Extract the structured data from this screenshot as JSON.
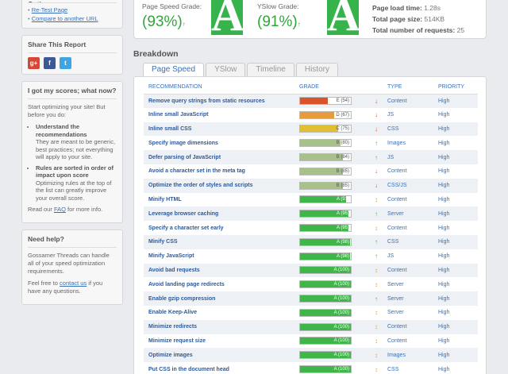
{
  "sidebar": {
    "top": {
      "title": "Options",
      "retest": "Re-Test Page",
      "compare": "Compare to another URL"
    },
    "share": {
      "title": "Share This Report"
    },
    "scores": {
      "title": "I got my scores; what now?",
      "intro": "Start optimizing your site! But before you do:",
      "item1_title": "Understand the recommendations",
      "item1_text": "They are meant to be generic, best practices; not everything will apply to your site.",
      "item2_title": "Rules are sorted in order of impact upon score",
      "item2_text": "Optimizing rules at the top of the list can greatly improve your overall score.",
      "read_pre": "Read our ",
      "faq": "FAQ",
      "read_post": " for more info."
    },
    "help": {
      "title": "Need help?",
      "text": "Gossamer Threads can handle all of your speed optimization requirements.",
      "feel_pre": "Feel free to ",
      "contact": "contact us",
      "feel_post": " if you have any questions."
    }
  },
  "grades": {
    "pagespeed_label": "Page Speed Grade:",
    "pagespeed_value": "(93%)",
    "yslow_label": "YSlow Grade:",
    "yslow_value": "(91%)",
    "letter": "A",
    "arrow": "↑",
    "load_time_label": "Page load time:",
    "load_time": "1.28s",
    "page_size_label": "Total page size:",
    "page_size": "514KB",
    "requests_label": "Total number of requests:",
    "requests": "25"
  },
  "breakdown": "Breakdown",
  "tabs": [
    "Page Speed",
    "YSlow",
    "Timeline",
    "History"
  ],
  "table": {
    "headers": [
      "RECOMMENDATION",
      "GRADE",
      "TYPE",
      "PRIORITY"
    ],
    "rows": [
      {
        "rec": "Remove query strings from static resources",
        "grade": "E (54)",
        "score": 54,
        "arrow": "↓",
        "type": "Content",
        "priority": "High",
        "color": "#d9542b"
      },
      {
        "rec": "Inline small JavaScript",
        "grade": "D (67)",
        "score": 67,
        "arrow": "↓",
        "type": "JS",
        "priority": "High",
        "color": "#e89b3c"
      },
      {
        "rec": "Inline small CSS",
        "grade": "C (75)",
        "score": 75,
        "arrow": "↓",
        "type": "CSS",
        "priority": "High",
        "color": "#e0c030"
      },
      {
        "rec": "Specify image dimensions",
        "grade": "B (80)",
        "score": 80,
        "arrow": "↑",
        "type": "Images",
        "priority": "High",
        "color": "#a8c08a"
      },
      {
        "rec": "Defer parsing of JavaScript",
        "grade": "B (84)",
        "score": 84,
        "arrow": "↑",
        "type": "JS",
        "priority": "High",
        "color": "#a8c08a"
      },
      {
        "rec": "Avoid a character set in the meta tag",
        "grade": "B (85)",
        "score": 85,
        "arrow": "↓",
        "type": "Content",
        "priority": "High",
        "color": "#a8c08a"
      },
      {
        "rec": "Optimize the order of styles and scripts",
        "grade": "B (85)",
        "score": 85,
        "arrow": "↓",
        "type": "CSS/JS",
        "priority": "High",
        "color": "#a8c08a"
      },
      {
        "rec": "Minify HTML",
        "grade": "A (91)",
        "score": 91,
        "arrow": "↕",
        "type": "Content",
        "priority": "High",
        "color": "#3fb54a"
      },
      {
        "rec": "Leverage browser caching",
        "grade": "A (95)",
        "score": 95,
        "arrow": "↑",
        "type": "Server",
        "priority": "High",
        "color": "#3fb54a"
      },
      {
        "rec": "Specify a character set early",
        "grade": "A (95)",
        "score": 95,
        "arrow": "↕",
        "type": "Content",
        "priority": "High",
        "color": "#3fb54a"
      },
      {
        "rec": "Minify CSS",
        "grade": "A (98)",
        "score": 98,
        "arrow": "↑",
        "type": "CSS",
        "priority": "High",
        "color": "#3fb54a"
      },
      {
        "rec": "Minify JavaScript",
        "grade": "A (98)",
        "score": 98,
        "arrow": "↑",
        "type": "JS",
        "priority": "High",
        "color": "#3fb54a"
      },
      {
        "rec": "Avoid bad requests",
        "grade": "A (100)",
        "score": 100,
        "arrow": "↕",
        "type": "Content",
        "priority": "High",
        "color": "#3fb54a"
      },
      {
        "rec": "Avoid landing page redirects",
        "grade": "A (100)",
        "score": 100,
        "arrow": "↕",
        "type": "Server",
        "priority": "High",
        "color": "#3fb54a"
      },
      {
        "rec": "Enable gzip compression",
        "grade": "A (100)",
        "score": 100,
        "arrow": "↑",
        "type": "Server",
        "priority": "High",
        "color": "#3fb54a"
      },
      {
        "rec": "Enable Keep-Alive",
        "grade": "A (100)",
        "score": 100,
        "arrow": "↕",
        "type": "Server",
        "priority": "High",
        "color": "#3fb54a"
      },
      {
        "rec": "Minimize redirects",
        "grade": "A (100)",
        "score": 100,
        "arrow": "↕",
        "type": "Content",
        "priority": "High",
        "color": "#3fb54a"
      },
      {
        "rec": "Minimize request size",
        "grade": "A (100)",
        "score": 100,
        "arrow": "↕",
        "type": "Content",
        "priority": "High",
        "color": "#3fb54a"
      },
      {
        "rec": "Optimize images",
        "grade": "A (100)",
        "score": 100,
        "arrow": "↕",
        "type": "Images",
        "priority": "High",
        "color": "#3fb54a"
      },
      {
        "rec": "Put CSS in the document head",
        "grade": "A (100)",
        "score": 100,
        "arrow": "↕",
        "type": "CSS",
        "priority": "High",
        "color": "#3fb54a"
      }
    ]
  }
}
